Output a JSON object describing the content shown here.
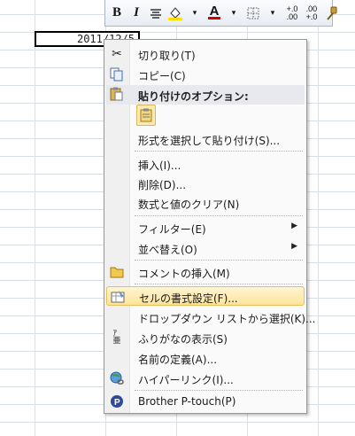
{
  "sheet": {
    "active_cell_value": "2011/12/5"
  },
  "mini_toolbar": {
    "bold": "B",
    "italic": "I",
    "font_color_glyph": "A",
    "increase_decimal": "+.0\n.00",
    "decrease_decimal": ".00\n+.0"
  },
  "context_menu": {
    "cut": "切り取り(T)",
    "copy": "コピー(C)",
    "paste_options_header": "貼り付けのオプション:",
    "paste_special": "形式を選択して貼り付け(S)...",
    "insert": "挿入(I)...",
    "delete": "削除(D)...",
    "clear_contents": "数式と値のクリア(N)",
    "filter": "フィルター(E)",
    "sort": "並べ替え(O)",
    "insert_comment": "コメントの挿入(M)",
    "format_cells": "セルの書式設定(F)...",
    "pick_from_dropdown": "ドロップダウン リストから選択(K)...",
    "show_furigana": "ふりがなの表示(S)",
    "define_name": "名前の定義(A)...",
    "hyperlink": "ハイパーリンク(I)...",
    "brother_ptouch": "Brother P-touch(P)"
  },
  "colors": {
    "highlight_top": "#fff5d2",
    "highlight_bottom": "#ffe39a",
    "font_color_bar": "#d00000"
  }
}
